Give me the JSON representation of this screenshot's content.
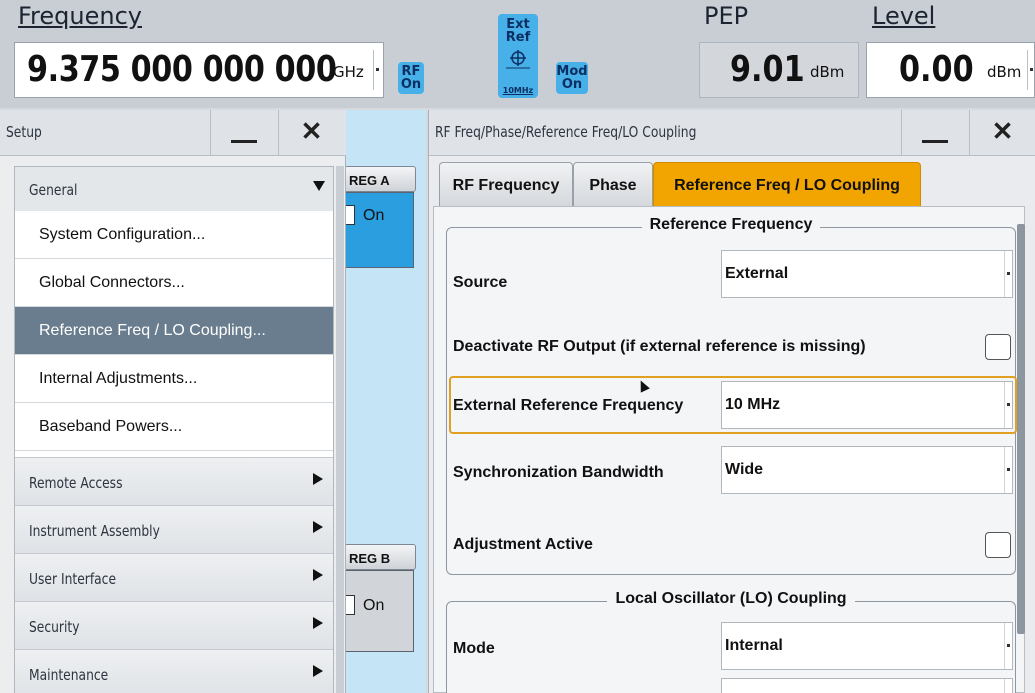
{
  "status_bar": {
    "frequency_label": "Frequency",
    "frequency_value": "9.375 000 000 000",
    "frequency_unit": "GHz",
    "rf_chip": [
      "RF",
      "On"
    ],
    "ext_ref_chip": [
      "Ext",
      "Ref"
    ],
    "ext_ref_sub": "10MHz",
    "mod_chip": [
      "Mod",
      "On"
    ],
    "pep_label": "PEP",
    "pep_value": "9.01",
    "pep_unit": "dBm",
    "level_label": "Level",
    "level_value": "0.00",
    "level_unit": "dBm"
  },
  "setup_panel": {
    "title": "Setup",
    "expanded_category": "General",
    "general_items": [
      {
        "label": "System Configuration...",
        "selected": false
      },
      {
        "label": "Global Connectors...",
        "selected": false
      },
      {
        "label": "Reference Freq / LO Coupling...",
        "selected": true
      },
      {
        "label": "Internal Adjustments...",
        "selected": false
      },
      {
        "label": "Baseband Powers...",
        "selected": false
      }
    ],
    "categories": [
      "Remote Access",
      "Instrument Assembly",
      "User Interface",
      "Security",
      "Maintenance"
    ]
  },
  "background_blocks": {
    "reg_a": "REG A",
    "reg_b": "REG B",
    "on_label": "On"
  },
  "dialog": {
    "title": "RF Freq/Phase/Reference Freq/LO Coupling",
    "tabs": [
      {
        "label": "RF Frequency",
        "active": false
      },
      {
        "label": "Phase",
        "active": false
      },
      {
        "label": "Reference Freq / LO Coupling",
        "active": true
      }
    ],
    "reference_frequency": {
      "heading": "Reference Frequency",
      "source_label": "Source",
      "source_value": "External",
      "deactivate_label": "Deactivate RF Output (if external reference is missing)",
      "deactivate_checked": false,
      "ext_ref_freq_label": "External Reference Frequency",
      "ext_ref_freq_value": "10 MHz",
      "sync_bw_label": "Synchronization Bandwidth",
      "sync_bw_value": "Wide",
      "adjustment_label": "Adjustment Active",
      "adjustment_checked": false
    },
    "lo_coupling": {
      "heading": "Local Oscillator (LO) Coupling",
      "mode_label": "Mode",
      "mode_value": "Internal"
    }
  },
  "colors": {
    "accent_tab": "#f2a400",
    "chip_blue": "#47b0e8",
    "selected_row": "#6a7d8f",
    "highlight_border": "#e0a020"
  }
}
